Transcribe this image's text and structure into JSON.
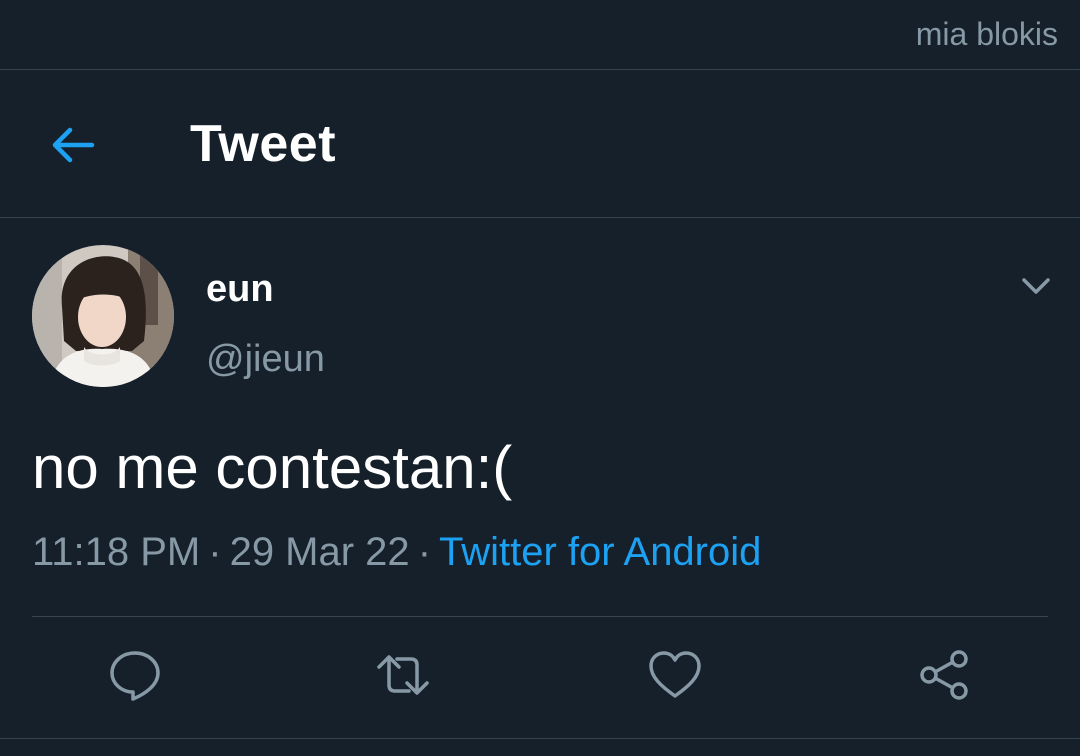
{
  "status_bar": {
    "user": "mia blokis"
  },
  "header": {
    "back_icon": "arrow-left-icon",
    "title": "Tweet"
  },
  "tweet": {
    "author": {
      "name": "eun",
      "handle": "@jieun"
    },
    "text": "no me contestan:(",
    "time": "11:18 PM",
    "date": "29 Mar 22",
    "source": "Twitter for Android",
    "separator": "·"
  },
  "actions": {
    "reply_icon": "reply-icon",
    "retweet_icon": "retweet-icon",
    "like_icon": "heart-icon",
    "share_icon": "share-icon"
  },
  "colors": {
    "background": "#15202b",
    "divider": "#38444d",
    "text_primary": "#ffffff",
    "text_secondary": "#8899a6",
    "accent": "#1da1f2"
  }
}
